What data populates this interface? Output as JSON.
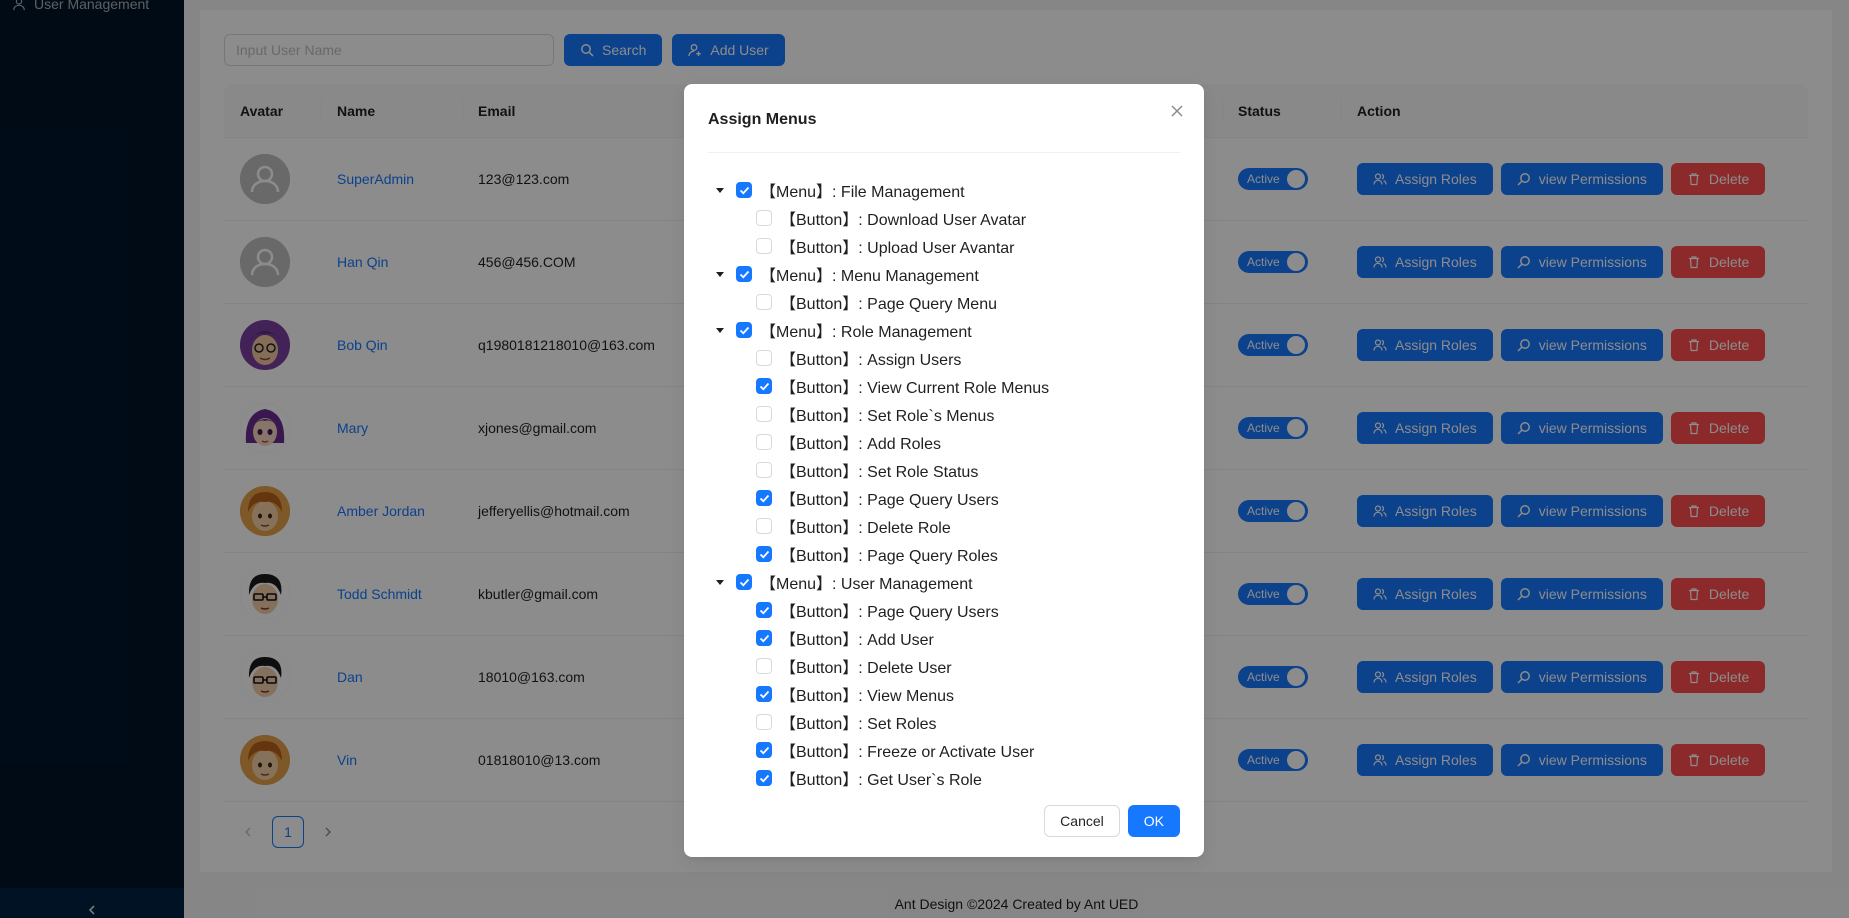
{
  "sider": {
    "menu_label": "User Management"
  },
  "toolbar": {
    "search_placeholder": "Input User Name",
    "search_label": "Search",
    "add_label": "Add User"
  },
  "table": {
    "columns": {
      "avatar": "Avatar",
      "name": "Name",
      "email": "Email",
      "status": "Status",
      "action": "Action"
    },
    "status_label": "Active",
    "actions": {
      "assign": "Assign Roles",
      "permissions": "view Permissions",
      "delete": "Delete"
    },
    "rows": [
      {
        "name": "SuperAdmin",
        "email": "123@123.com",
        "avatar": "default",
        "status": "Active"
      },
      {
        "name": "Han Qin",
        "email": "456@456.COM",
        "avatar": "default",
        "status": "Active"
      },
      {
        "name": "Bob Qin",
        "email": "q1980181218010@163.com",
        "avatar": "purple-glasses",
        "status": "Active"
      },
      {
        "name": "Mary",
        "email": "xjones@gmail.com",
        "avatar": "purple-hair",
        "status": "Active"
      },
      {
        "name": "Amber Jordan",
        "email": "jefferyellis@hotmail.com",
        "avatar": "brown-hair",
        "status": "Active"
      },
      {
        "name": "Todd Schmidt",
        "email": "kbutler@gmail.com",
        "avatar": "dark-glasses",
        "status": "Active"
      },
      {
        "name": "Dan",
        "email": "18010@163.com",
        "avatar": "dark-glasses",
        "status": "Active"
      },
      {
        "name": "Vin",
        "email": "01818010@13.com",
        "avatar": "brown-hair",
        "status": "Active"
      }
    ]
  },
  "pagination": {
    "current": "1"
  },
  "footer": {
    "text": "Ant Design ©2024 Created by Ant UED"
  },
  "modal": {
    "title": "Assign Menus",
    "cancel_label": "Cancel",
    "ok_label": "OK",
    "tree": [
      {
        "type": "menu",
        "label": "【Menu】: File Management",
        "checked": true
      },
      {
        "type": "button",
        "label": "【Button】: Download User Avatar",
        "checked": false
      },
      {
        "type": "button",
        "label": "【Button】: Upload User Avantar",
        "checked": false
      },
      {
        "type": "menu",
        "label": "【Menu】: Menu Management",
        "checked": true
      },
      {
        "type": "button",
        "label": "【Button】: Page Query Menu",
        "checked": false
      },
      {
        "type": "menu",
        "label": "【Menu】: Role Management",
        "checked": true
      },
      {
        "type": "button",
        "label": "【Button】: Assign Users",
        "checked": false
      },
      {
        "type": "button",
        "label": "【Button】: View Current Role Menus",
        "checked": true
      },
      {
        "type": "button",
        "label": "【Button】: Set Role`s Menus",
        "checked": false
      },
      {
        "type": "button",
        "label": "【Button】: Add Roles",
        "checked": false
      },
      {
        "type": "button",
        "label": "【Button】: Set Role Status",
        "checked": false
      },
      {
        "type": "button",
        "label": "【Button】: Page Query Users",
        "checked": true
      },
      {
        "type": "button",
        "label": "【Button】: Delete Role",
        "checked": false
      },
      {
        "type": "button",
        "label": "【Button】: Page Query Roles",
        "checked": true
      },
      {
        "type": "menu",
        "label": "【Menu】: User Management",
        "checked": true
      },
      {
        "type": "button",
        "label": "【Button】: Page Query Users",
        "checked": true
      },
      {
        "type": "button",
        "label": "【Button】: Add User",
        "checked": true
      },
      {
        "type": "button",
        "label": "【Button】: Delete User",
        "checked": false
      },
      {
        "type": "button",
        "label": "【Button】: View Menus",
        "checked": true
      },
      {
        "type": "button",
        "label": "【Button】: Set Roles",
        "checked": false
      },
      {
        "type": "button",
        "label": "【Button】: Freeze or Activate User",
        "checked": true
      },
      {
        "type": "button",
        "label": "【Button】: Get User`s Role",
        "checked": true
      }
    ]
  },
  "colors": {
    "primary": "#1677ff",
    "danger": "#ff4d4f",
    "sider": "#001529"
  }
}
